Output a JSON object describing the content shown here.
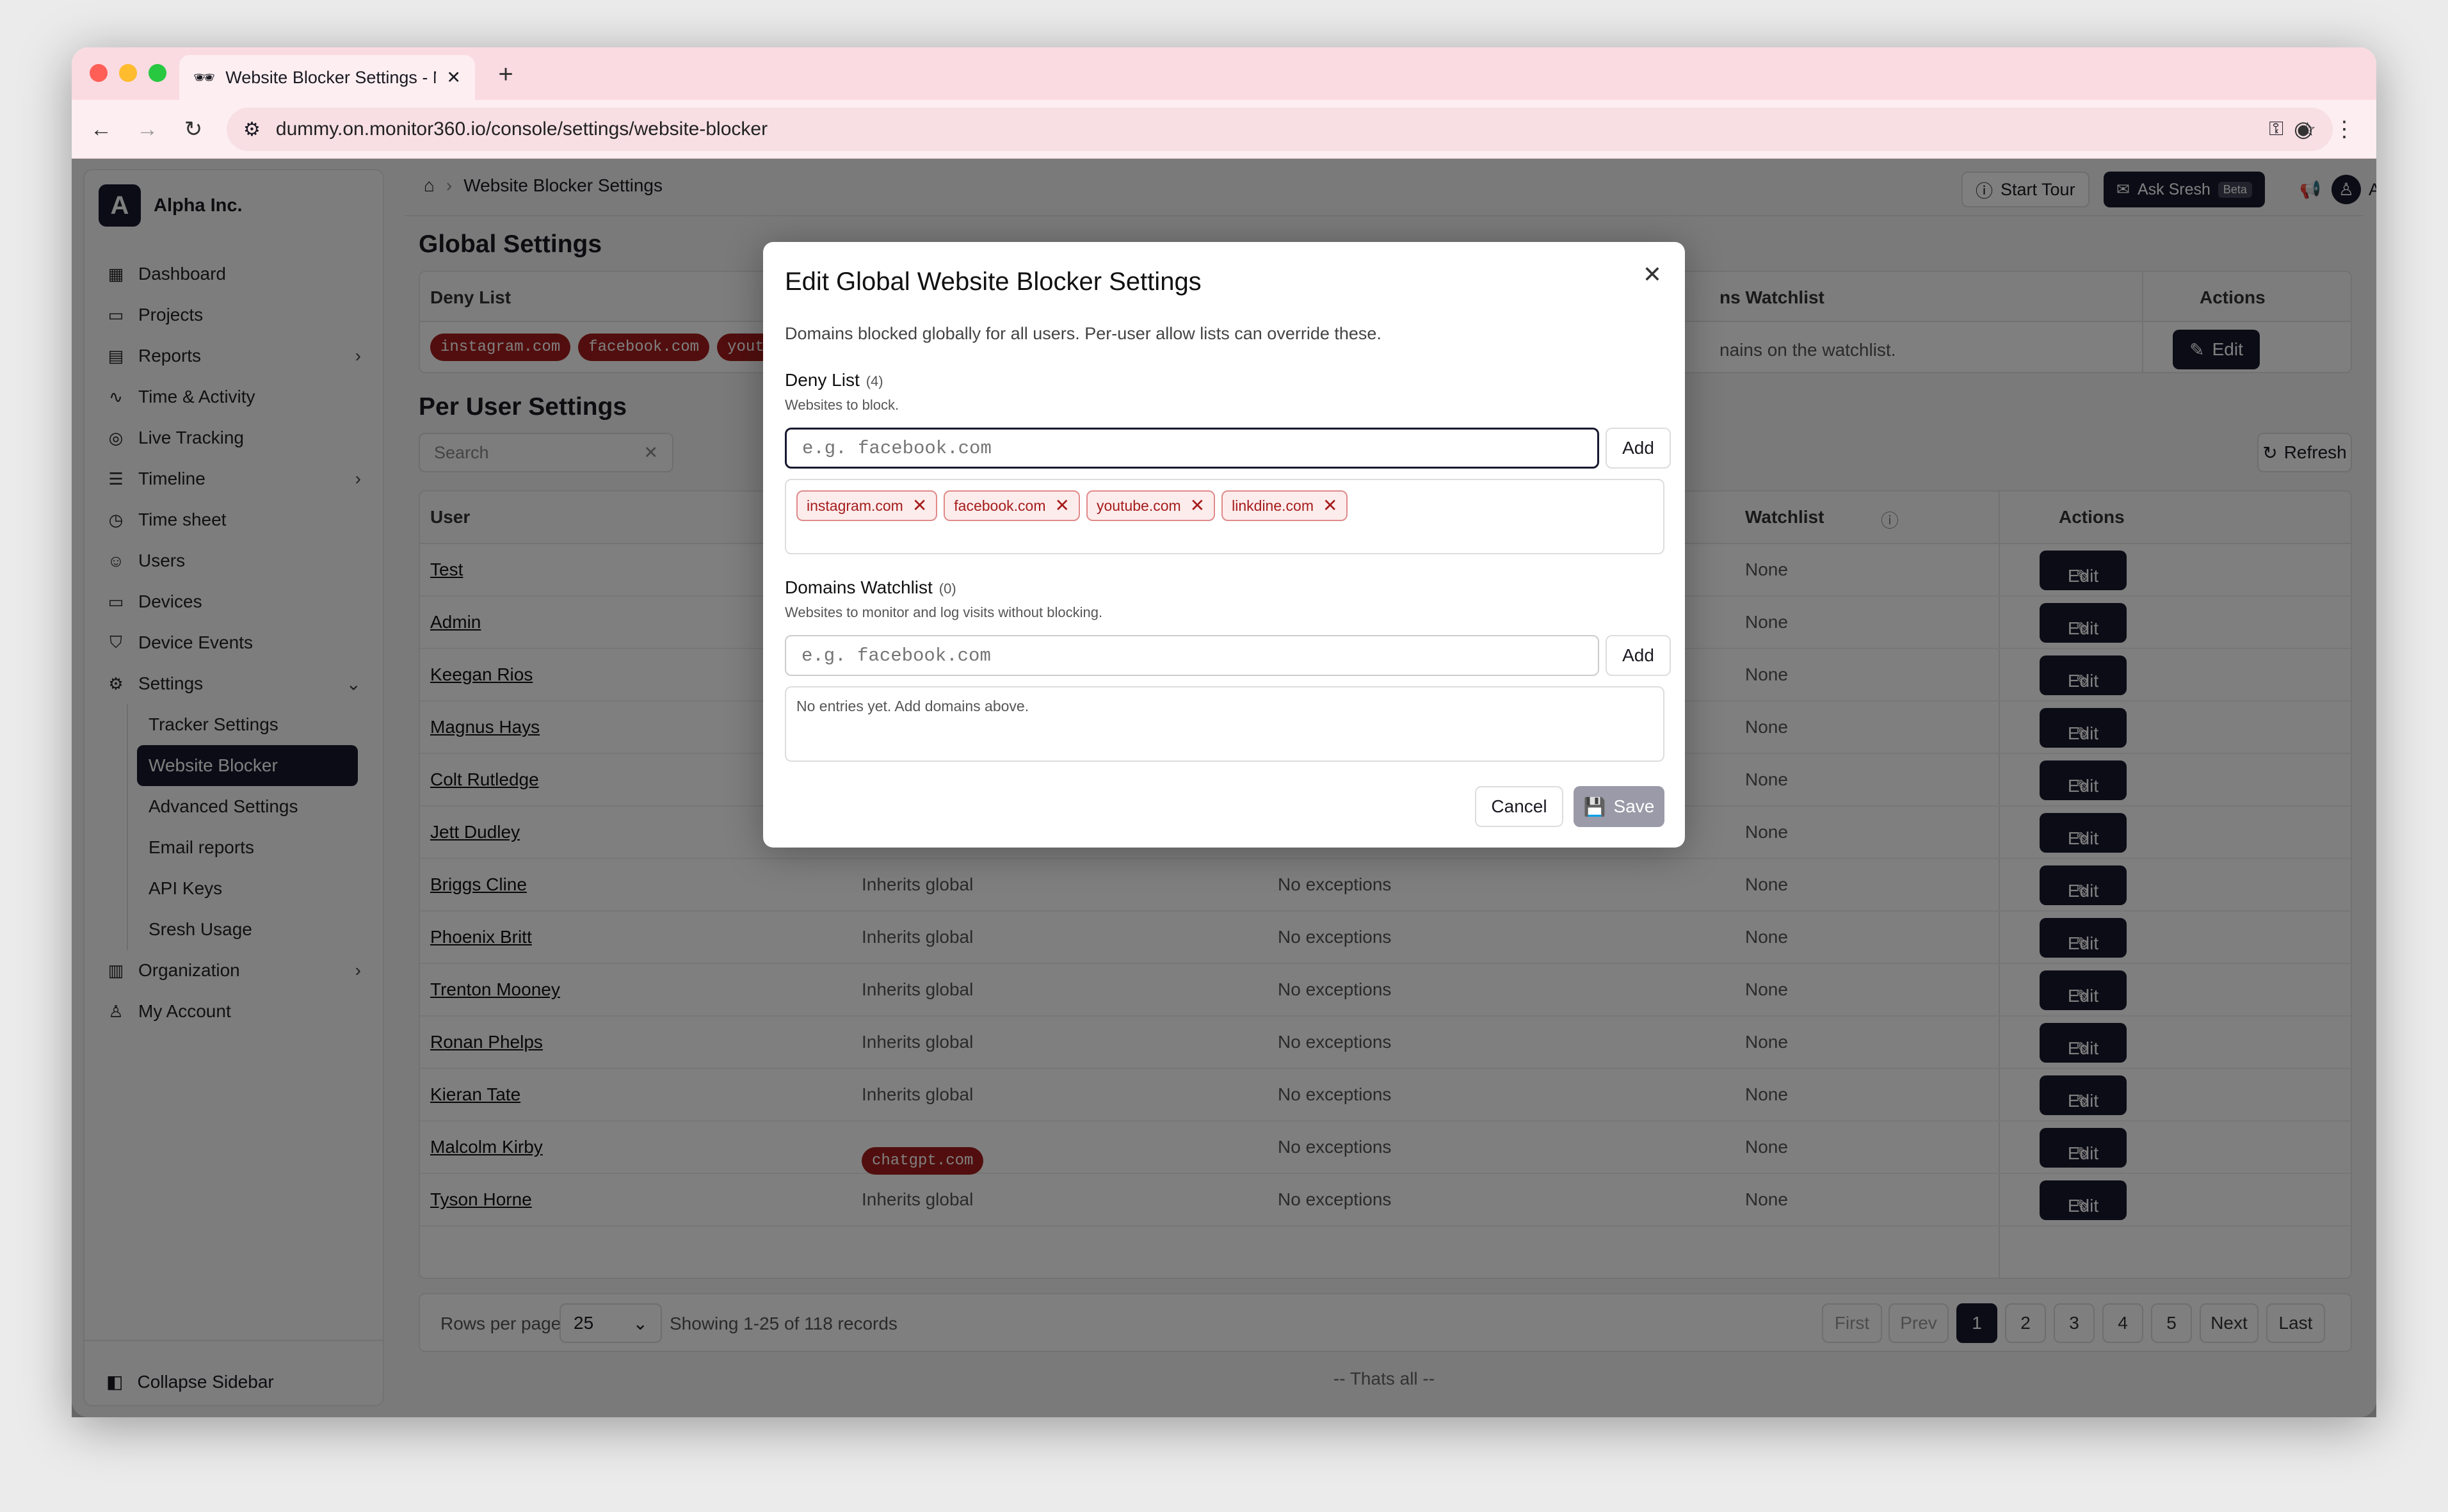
{
  "browser": {
    "tab_title": "Website Blocker Settings - M",
    "url": "dummy.on.monitor360.io/console/settings/website-blocker"
  },
  "sidebar": {
    "org_initial": "A",
    "org_name": "Alpha Inc.",
    "items": [
      {
        "label": "Dashboard",
        "icon": "grid-icon"
      },
      {
        "label": "Projects",
        "icon": "folder-icon"
      },
      {
        "label": "Reports",
        "icon": "file-icon",
        "chevron": ">"
      },
      {
        "label": "Time & Activity",
        "icon": "activity-icon"
      },
      {
        "label": "Live Tracking",
        "icon": "radio-icon"
      },
      {
        "label": "Timeline",
        "icon": "timeline-icon",
        "chevron": ">"
      },
      {
        "label": "Time sheet",
        "icon": "clock-icon"
      },
      {
        "label": "Users",
        "icon": "users-icon"
      },
      {
        "label": "Devices",
        "icon": "monitor-icon"
      },
      {
        "label": "Device Events",
        "icon": "shield-icon"
      },
      {
        "label": "Settings",
        "icon": "gear-icon",
        "chevron": "v"
      }
    ],
    "settings_sub": [
      "Tracker Settings",
      "Website Blocker",
      "Advanced Settings",
      "Email reports",
      "API Keys",
      "Sresh Usage"
    ],
    "bottom_items": [
      {
        "label": "Organization",
        "icon": "building-icon",
        "chevron": ">"
      },
      {
        "label": "My Account",
        "icon": "user-icon"
      }
    ],
    "collapse_label": "Collapse Sidebar"
  },
  "topbar": {
    "breadcrumb": "Website Blocker Settings",
    "start_tour": "Start Tour",
    "ask_sresh": "Ask Sresh",
    "beta": "Beta",
    "user": "Admin"
  },
  "global": {
    "heading": "Global Settings",
    "deny_header": "Deny List",
    "watchlist_header": "ns Watchlist",
    "actions_header": "Actions",
    "pills": [
      "instagram.com",
      "facebook.com",
      "youtu"
    ],
    "watchlist_text": "nains on the watchlist.",
    "edit": "Edit"
  },
  "per_user": {
    "heading": "Per User Settings",
    "search_placeholder": "Search",
    "refresh": "Refresh",
    "col_user": "User",
    "col_watchlist": "Watchlist",
    "col_actions": "Actions",
    "rows": [
      {
        "name": "Test",
        "c2": "",
        "c3": "",
        "c4": "None"
      },
      {
        "name": "Admin",
        "c2": "",
        "c3": "",
        "c4": "None"
      },
      {
        "name": "Keegan Rios",
        "c2": "",
        "c3": "",
        "c4": "None"
      },
      {
        "name": "Magnus Hays",
        "c2": "",
        "c3": "",
        "c4": "None"
      },
      {
        "name": "Colt Rutledge",
        "c2": "",
        "c3": "",
        "c4": "None"
      },
      {
        "name": "Jett Dudley",
        "c2": "",
        "c3": "",
        "c4": "None"
      },
      {
        "name": "Briggs Cline",
        "c2": "Inherits global",
        "c3": "No exceptions",
        "c4": "None"
      },
      {
        "name": "Phoenix Britt",
        "c2": "Inherits global",
        "c3": "No exceptions",
        "c4": "None"
      },
      {
        "name": "Trenton Mooney",
        "c2": "Inherits global",
        "c3": "No exceptions",
        "c4": "None"
      },
      {
        "name": "Ronan Phelps",
        "c2": "Inherits global",
        "c3": "No exceptions",
        "c4": "None"
      },
      {
        "name": "Kieran Tate",
        "c2": "Inherits global",
        "c3": "No exceptions",
        "c4": "None"
      },
      {
        "name": "Malcolm Kirby",
        "c2": "",
        "pill": "chatgpt.com",
        "c3": "No exceptions",
        "c4": "None"
      },
      {
        "name": "Tyson Horne",
        "c2": "Inherits global",
        "c3": "No exceptions",
        "c4": "None"
      }
    ],
    "edit": "Edit"
  },
  "pager": {
    "rows_label": "Rows per page",
    "rows_value": "25",
    "showing": "Showing 1-25 of 118 records",
    "first": "First",
    "prev": "Prev",
    "pages": [
      "1",
      "2",
      "3",
      "4",
      "5"
    ],
    "next": "Next",
    "last": "Last",
    "footer": "-- Thats all --"
  },
  "modal": {
    "title": "Edit Global Website Blocker Settings",
    "description": "Domains blocked globally for all users. Per-user allow lists can override these.",
    "deny_label": "Deny List",
    "deny_count": "(4)",
    "deny_help": "Websites to block.",
    "input_placeholder": "e.g. facebook.com",
    "add": "Add",
    "deny_chips": [
      "instagram.com",
      "facebook.com",
      "youtube.com",
      "linkdine.com"
    ],
    "watch_label": "Domains Watchlist",
    "watch_count": "(0)",
    "watch_help": "Websites to monitor and log visits without blocking.",
    "watch_empty": "No entries yet. Add domains above.",
    "cancel": "Cancel",
    "save": "Save"
  },
  "colors": {
    "accent": "#18182f",
    "danger": "#a51c1c",
    "tabbar": "#fadbe1"
  }
}
